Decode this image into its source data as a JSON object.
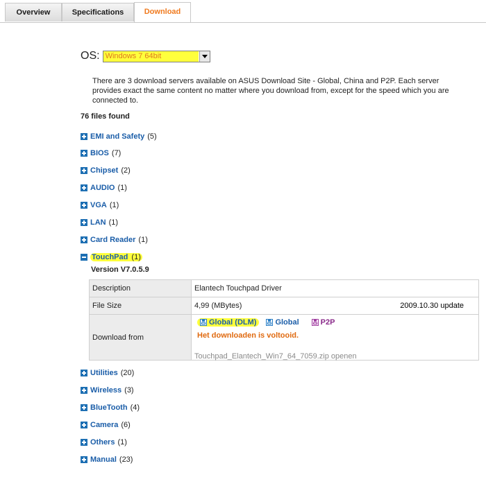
{
  "tabs": [
    {
      "label": "Overview"
    },
    {
      "label": "Specifications"
    },
    {
      "label": "Download"
    }
  ],
  "os": {
    "label": "OS:",
    "selected": "Windows 7 64bit"
  },
  "intro_text": "There are 3 download servers available on ASUS Download Site - Global, China and P2P. Each server provides exact the same content no matter where you download from, except for the speed which you are connected to.",
  "files_found": "76 files found",
  "categories": [
    {
      "name": "EMI and Safety",
      "count": "(5)"
    },
    {
      "name": "BIOS",
      "count": "(7)"
    },
    {
      "name": "Chipset",
      "count": "(2)"
    },
    {
      "name": "AUDIO",
      "count": "(1)"
    },
    {
      "name": "VGA",
      "count": "(1)"
    },
    {
      "name": "LAN",
      "count": "(1)"
    },
    {
      "name": "Card Reader",
      "count": "(1)"
    },
    {
      "name": "TouchPad",
      "count": "(1)"
    },
    {
      "name": "Utilities",
      "count": "(20)"
    },
    {
      "name": "Wireless",
      "count": "(3)"
    },
    {
      "name": "BlueTooth",
      "count": "(4)"
    },
    {
      "name": "Camera",
      "count": "(6)"
    },
    {
      "name": "Others",
      "count": "(1)"
    },
    {
      "name": "Manual",
      "count": "(23)"
    }
  ],
  "touchpad": {
    "version": "Version  V7.0.5.9",
    "description_label": "Description",
    "description_value": "Elantech Touchpad Driver",
    "filesize_label": "File Size",
    "filesize_value": "4,99 (MBytes)",
    "date_value": "2009.10.30  update",
    "download_label": "Download from",
    "link_global_dlm": "Global (DLM)",
    "link_global": "Global",
    "link_p2p": "P2P",
    "status": "Het downloaden is voltooid.",
    "file_open": "Touchpad_Elantech_Win7_64_7059.zip openen"
  },
  "colors": {
    "highlight": "#ffff3c",
    "link": "#1a5da8",
    "accent_orange": "#f07a1e",
    "plus_box": "#1d6fb3"
  }
}
